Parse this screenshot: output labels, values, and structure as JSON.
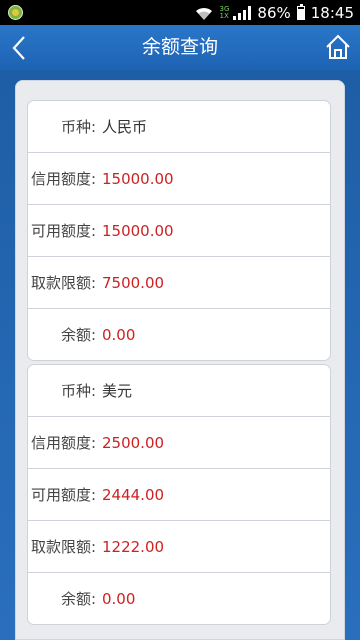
{
  "status_bar": {
    "battery": "86%",
    "time": "18:45",
    "network_top": "3G",
    "network_bottom": "1X"
  },
  "header": {
    "title": "余额查询"
  },
  "accounts": [
    {
      "currency_label": "币种:",
      "currency": "人民币",
      "credit_label": "信用额度:",
      "credit": "15000.00",
      "available_label": "可用额度:",
      "available": "15000.00",
      "withdraw_label": "取款限额:",
      "withdraw": "7500.00",
      "balance_label": "余额:",
      "balance": "0.00"
    },
    {
      "currency_label": "币种:",
      "currency": "美元",
      "credit_label": "信用额度:",
      "credit": "2500.00",
      "available_label": "可用额度:",
      "available": "2444.00",
      "withdraw_label": "取款限额:",
      "withdraw": "1222.00",
      "balance_label": "余额:",
      "balance": "0.00"
    }
  ],
  "colors": {
    "header_bg": "#2a76c8",
    "value_red": "#cc2222"
  }
}
